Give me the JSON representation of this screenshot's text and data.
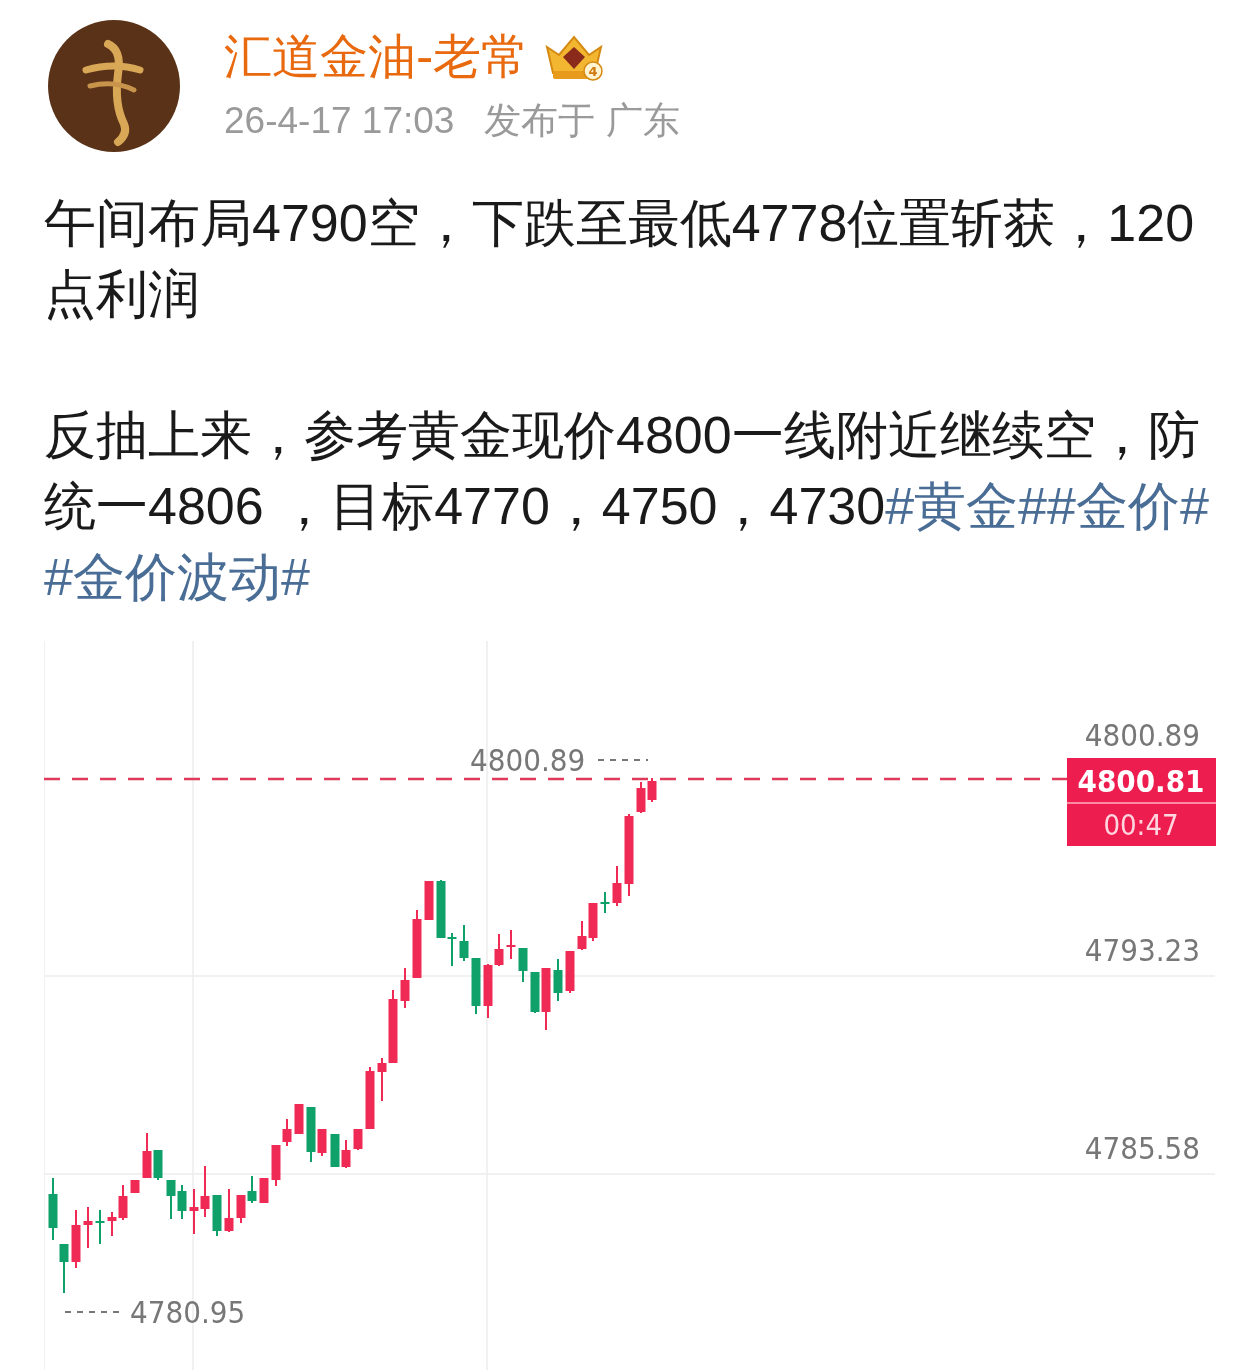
{
  "author": {
    "name": "汇道金油-老常",
    "badge_level": "4"
  },
  "meta": {
    "time": "26-4-17 17:03",
    "location": "发布于 广东"
  },
  "paragraphs": [
    {
      "segments": [
        {
          "kind": "text",
          "text": "午间布局4790空，下跌至最低4778位置斩获，120点利润"
        }
      ]
    },
    {
      "segments": [
        {
          "kind": "text",
          "text": "反抽上来，参考黄金现价4800一线附近继续空，防统一4806 ，目标4770，4750，4730"
        },
        {
          "kind": "topic",
          "text": "#黄金#"
        },
        {
          "kind": "topic",
          "text": "#金价#"
        },
        {
          "kind": "topic",
          "text": "#金价波动#"
        }
      ]
    }
  ],
  "chart": {
    "high_label": "4800.89",
    "low_label": "4780.95",
    "price_axis": [
      "4800.89",
      "4793.23",
      "4785.58"
    ],
    "last_price": "4800.81",
    "countdown": "00:47"
  }
}
